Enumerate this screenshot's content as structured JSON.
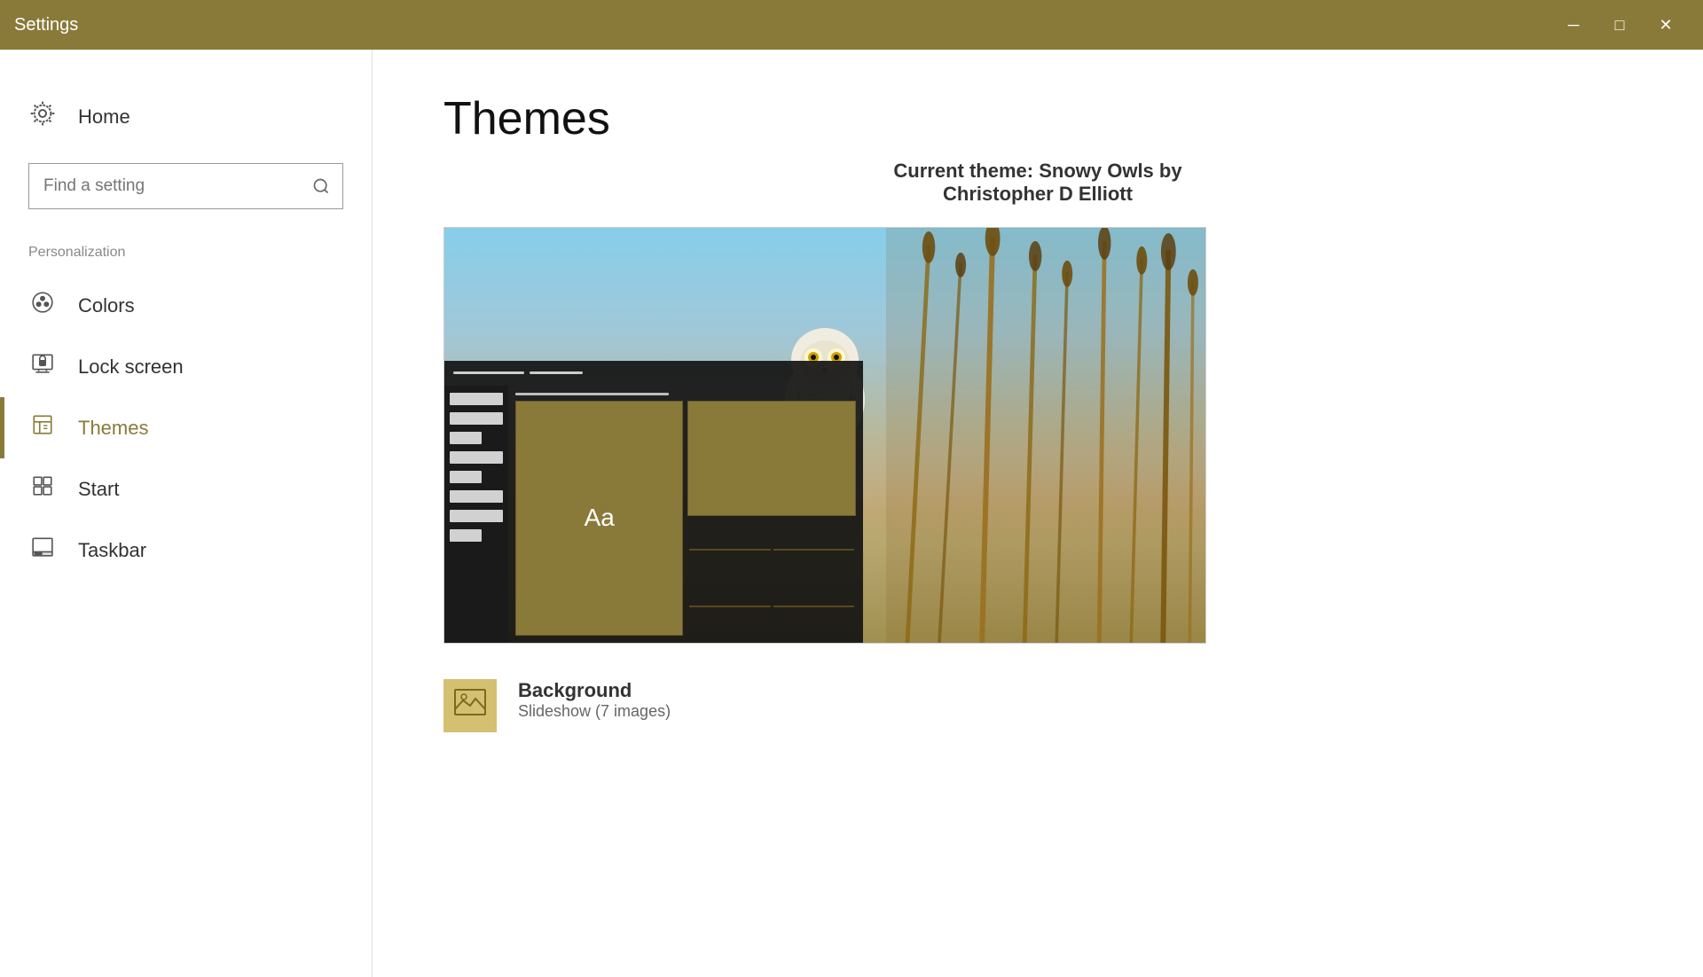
{
  "titlebar": {
    "title": "Settings",
    "minimize_label": "─",
    "maximize_label": "□",
    "close_label": "✕"
  },
  "sidebar": {
    "home_label": "Home",
    "search_placeholder": "Find a setting",
    "section_label": "Personalization",
    "items": [
      {
        "id": "colors",
        "label": "Colors",
        "icon": "palette"
      },
      {
        "id": "lock-screen",
        "label": "Lock screen",
        "icon": "monitor-lock"
      },
      {
        "id": "themes",
        "label": "Themes",
        "icon": "themes",
        "active": true
      },
      {
        "id": "start",
        "label": "Start",
        "icon": "start"
      },
      {
        "id": "taskbar",
        "label": "Taskbar",
        "icon": "taskbar"
      }
    ]
  },
  "content": {
    "page_title": "Themes",
    "current_theme_text": "Current theme: Snowy Owls by Christopher D Elliott",
    "background_section": {
      "title": "Background",
      "subtitle": "Slideshow (7 images)"
    }
  },
  "theme_preview": {
    "aa_label": "Aa"
  }
}
